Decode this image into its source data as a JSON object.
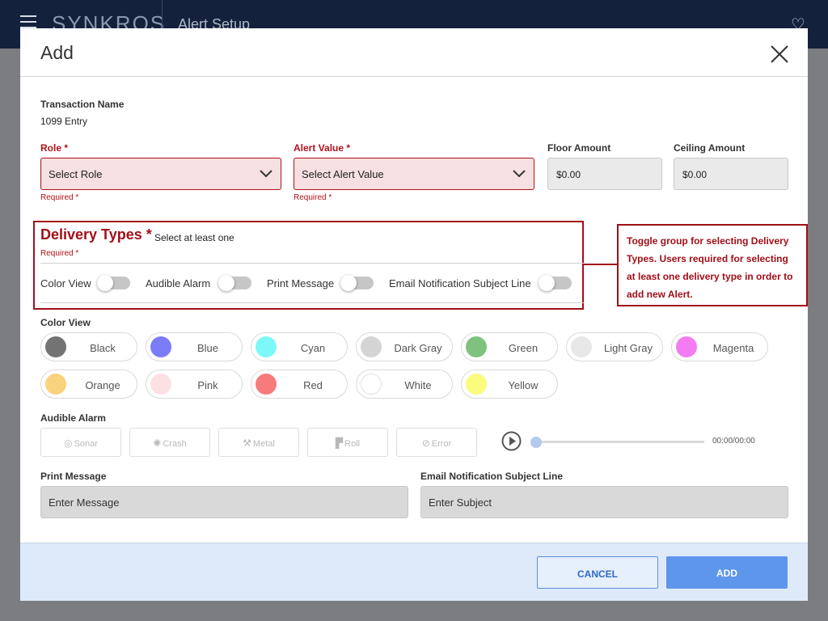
{
  "topbar": {
    "brand": "SYNKROS",
    "title": "Alert Setup"
  },
  "modal": {
    "title": "Add",
    "transaction": {
      "label": "Transaction Name",
      "value": "1099 Entry"
    },
    "role": {
      "label": "Role *",
      "placeholder": "Select Role",
      "required": "Required *"
    },
    "alert_value": {
      "label": "Alert Value *",
      "placeholder": "Select Alert Value",
      "required": "Required *"
    },
    "floor": {
      "label": "Floor Amount",
      "value": "$0.00"
    },
    "ceiling": {
      "label": "Ceiling Amount",
      "value": "$0.00"
    },
    "delivery": {
      "title": "Delivery Types",
      "asterisk": "*",
      "subtitle": "Select at least one",
      "required": "Required *",
      "toggles": [
        {
          "label": "Color View",
          "on": false
        },
        {
          "label": "Audible Alarm",
          "on": false
        },
        {
          "label": "Print Message",
          "on": false
        },
        {
          "label": "Email Notification Subject Line",
          "on": false
        }
      ]
    },
    "callout": "Toggle group for selecting Delivery Types. Users required for selecting at least one delivery type in order to add new Alert.",
    "color_view": {
      "label": "Color View",
      "colors": [
        {
          "name": "Black",
          "color": "#737373"
        },
        {
          "name": "Blue",
          "color": "#7b7cf7"
        },
        {
          "name": "Cyan",
          "color": "#7cf8f8"
        },
        {
          "name": "Dark Gray",
          "color": "#d4d4d4"
        },
        {
          "name": "Green",
          "color": "#7ec27e"
        },
        {
          "name": "Light Gray",
          "color": "#e8e8e8"
        },
        {
          "name": "Magenta",
          "color": "#f37cf3"
        },
        {
          "name": "Orange",
          "color": "#fbd27e"
        },
        {
          "name": "Pink",
          "color": "#fde0e4"
        },
        {
          "name": "Red",
          "color": "#f77b7b"
        },
        {
          "name": "White",
          "color": "#ffffff"
        },
        {
          "name": "Yellow",
          "color": "#fbfb7e"
        }
      ]
    },
    "audible_alarm": {
      "label": "Audible Alarm",
      "sounds": [
        {
          "name": "Sonar",
          "icon": "sonar-icon"
        },
        {
          "name": "Crash",
          "icon": "crash-icon"
        },
        {
          "name": "Metal",
          "icon": "wrench-icon"
        },
        {
          "name": "Roll",
          "icon": "paint-roller-icon"
        },
        {
          "name": "Error",
          "icon": "error-icon"
        }
      ],
      "progress": 0,
      "time": "00:00/00:00"
    },
    "print_message": {
      "label": "Print Message",
      "placeholder": "Enter Message"
    },
    "email_subject": {
      "label": "Email Notification Subject Line",
      "placeholder": "Enter Subject"
    },
    "footer": {
      "cancel": "CANCEL",
      "add": "ADD"
    }
  }
}
